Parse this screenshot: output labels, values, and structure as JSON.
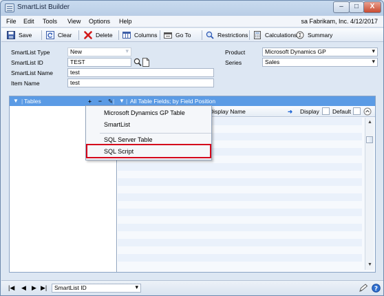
{
  "window": {
    "title": "SmartList Builder",
    "min": "–",
    "max": "□",
    "close": "X"
  },
  "menu": {
    "items": [
      "File",
      "Edit",
      "Tools",
      "View",
      "Options",
      "Help"
    ],
    "user_info": "sa  Fabrikam, Inc.  4/12/2017"
  },
  "toolbar": {
    "save": "Save",
    "clear": "Clear",
    "delete": "Delete",
    "columns": "Columns",
    "goto": "Go To",
    "restrictions": "Restrictions",
    "calculations": "Calculations",
    "summary": "Summary"
  },
  "form": {
    "smartlist_type_label": "SmartList Type",
    "smartlist_type_value": "New",
    "smartlist_id_label": "SmartList ID",
    "smartlist_id_value": "TEST",
    "smartlist_name_label": "SmartList Name",
    "smartlist_name_value": "test",
    "item_name_label": "Item Name",
    "item_name_value": "test",
    "product_label": "Product",
    "product_value": "Microsoft Dynamics GP",
    "series_label": "Series",
    "series_value": "Sales"
  },
  "panel": {
    "tables_label": "Tables",
    "plus": "+",
    "minus": "−",
    "fields_header": "All Table Fields; by Field Position",
    "col_display_name": "Display Name",
    "col_display": "Display",
    "col_default": "Default"
  },
  "dropdown": {
    "items": [
      "Microsoft Dynamics GP Table",
      "SmartList",
      "SQL Server Table",
      "SQL Script"
    ],
    "highlighted": "SQL Script"
  },
  "statusbar": {
    "nav_first": "|◀",
    "nav_prev": "◀",
    "nav_next": "▶",
    "nav_last": "▶|",
    "sort_value": "SmartList ID"
  },
  "colors": {
    "panel_header": "#5b9be5",
    "highlight_border": "#d4001a"
  }
}
